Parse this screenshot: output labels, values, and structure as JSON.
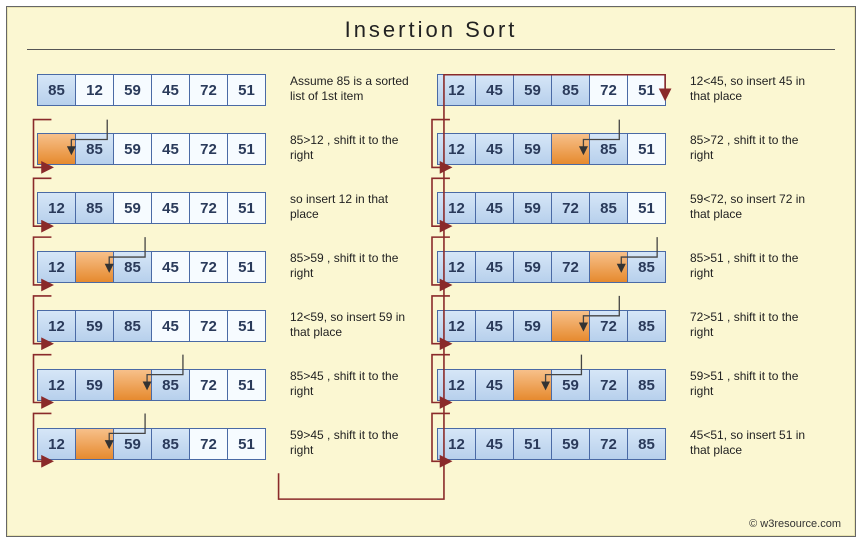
{
  "title": "Insertion  Sort",
  "footer": "© w3resource.com",
  "leftSteps": [
    {
      "cells": [
        {
          "v": "85",
          "c": "blue"
        },
        {
          "v": "12",
          "c": ""
        },
        {
          "v": "59",
          "c": ""
        },
        {
          "v": "45",
          "c": ""
        },
        {
          "v": "72",
          "c": ""
        },
        {
          "v": "51",
          "c": ""
        }
      ],
      "desc": "Assume 85 is a sorted list of 1st item"
    },
    {
      "cells": [
        {
          "v": "",
          "c": "orange"
        },
        {
          "v": "85",
          "c": "blue"
        },
        {
          "v": "59",
          "c": ""
        },
        {
          "v": "45",
          "c": ""
        },
        {
          "v": "72",
          "c": ""
        },
        {
          "v": "51",
          "c": ""
        }
      ],
      "desc": "85>12 , shift it to the right"
    },
    {
      "cells": [
        {
          "v": "12",
          "c": "blue"
        },
        {
          "v": "85",
          "c": "blue"
        },
        {
          "v": "59",
          "c": ""
        },
        {
          "v": "45",
          "c": ""
        },
        {
          "v": "72",
          "c": ""
        },
        {
          "v": "51",
          "c": ""
        }
      ],
      "desc": "so insert 12 in that place"
    },
    {
      "cells": [
        {
          "v": "12",
          "c": "blue"
        },
        {
          "v": "",
          "c": "orange"
        },
        {
          "v": "85",
          "c": "blue"
        },
        {
          "v": "45",
          "c": ""
        },
        {
          "v": "72",
          "c": ""
        },
        {
          "v": "51",
          "c": ""
        }
      ],
      "desc": "85>59 , shift it to the right"
    },
    {
      "cells": [
        {
          "v": "12",
          "c": "blue"
        },
        {
          "v": "59",
          "c": "blue"
        },
        {
          "v": "85",
          "c": "blue"
        },
        {
          "v": "45",
          "c": ""
        },
        {
          "v": "72",
          "c": ""
        },
        {
          "v": "51",
          "c": ""
        }
      ],
      "desc": "12<59, so insert 59 in that place"
    },
    {
      "cells": [
        {
          "v": "12",
          "c": "blue"
        },
        {
          "v": "59",
          "c": "blue"
        },
        {
          "v": "",
          "c": "orange"
        },
        {
          "v": "85",
          "c": "blue"
        },
        {
          "v": "72",
          "c": ""
        },
        {
          "v": "51",
          "c": ""
        }
      ],
      "desc": "85>45 , shift it to the right"
    },
    {
      "cells": [
        {
          "v": "12",
          "c": "blue"
        },
        {
          "v": "",
          "c": "orange"
        },
        {
          "v": "59",
          "c": "blue"
        },
        {
          "v": "85",
          "c": "blue"
        },
        {
          "v": "72",
          "c": ""
        },
        {
          "v": "51",
          "c": ""
        }
      ],
      "desc": "59>45 , shift it to the right"
    }
  ],
  "rightSteps": [
    {
      "cells": [
        {
          "v": "12",
          "c": "blue"
        },
        {
          "v": "45",
          "c": "blue"
        },
        {
          "v": "59",
          "c": "blue"
        },
        {
          "v": "85",
          "c": "blue"
        },
        {
          "v": "72",
          "c": ""
        },
        {
          "v": "51",
          "c": ""
        }
      ],
      "desc": "12<45, so insert 45 in that place"
    },
    {
      "cells": [
        {
          "v": "12",
          "c": "blue"
        },
        {
          "v": "45",
          "c": "blue"
        },
        {
          "v": "59",
          "c": "blue"
        },
        {
          "v": "",
          "c": "orange"
        },
        {
          "v": "85",
          "c": "blue"
        },
        {
          "v": "51",
          "c": ""
        }
      ],
      "desc": "85>72 , shift it to the right"
    },
    {
      "cells": [
        {
          "v": "12",
          "c": "blue"
        },
        {
          "v": "45",
          "c": "blue"
        },
        {
          "v": "59",
          "c": "blue"
        },
        {
          "v": "72",
          "c": "blue"
        },
        {
          "v": "85",
          "c": "blue"
        },
        {
          "v": "51",
          "c": ""
        }
      ],
      "desc": "59<72, so insert 72 in that place"
    },
    {
      "cells": [
        {
          "v": "12",
          "c": "blue"
        },
        {
          "v": "45",
          "c": "blue"
        },
        {
          "v": "59",
          "c": "blue"
        },
        {
          "v": "72",
          "c": "blue"
        },
        {
          "v": "",
          "c": "orange"
        },
        {
          "v": "85",
          "c": "blue"
        }
      ],
      "desc": "85>51 , shift it to the right"
    },
    {
      "cells": [
        {
          "v": "12",
          "c": "blue"
        },
        {
          "v": "45",
          "c": "blue"
        },
        {
          "v": "59",
          "c": "blue"
        },
        {
          "v": "",
          "c": "orange"
        },
        {
          "v": "72",
          "c": "blue"
        },
        {
          "v": "85",
          "c": "blue"
        }
      ],
      "desc": "72>51 , shift it to the right"
    },
    {
      "cells": [
        {
          "v": "12",
          "c": "blue"
        },
        {
          "v": "45",
          "c": "blue"
        },
        {
          "v": "",
          "c": "orange"
        },
        {
          "v": "59",
          "c": "blue"
        },
        {
          "v": "72",
          "c": "blue"
        },
        {
          "v": "85",
          "c": "blue"
        }
      ],
      "desc": "59>51 , shift it to the right"
    },
    {
      "cells": [
        {
          "v": "12",
          "c": "blue"
        },
        {
          "v": "45",
          "c": "blue"
        },
        {
          "v": "51",
          "c": "blue"
        },
        {
          "v": "59",
          "c": "blue"
        },
        {
          "v": "72",
          "c": "blue"
        },
        {
          "v": "85",
          "c": "blue"
        }
      ],
      "desc": "45<51, so insert 51 in that place"
    }
  ]
}
